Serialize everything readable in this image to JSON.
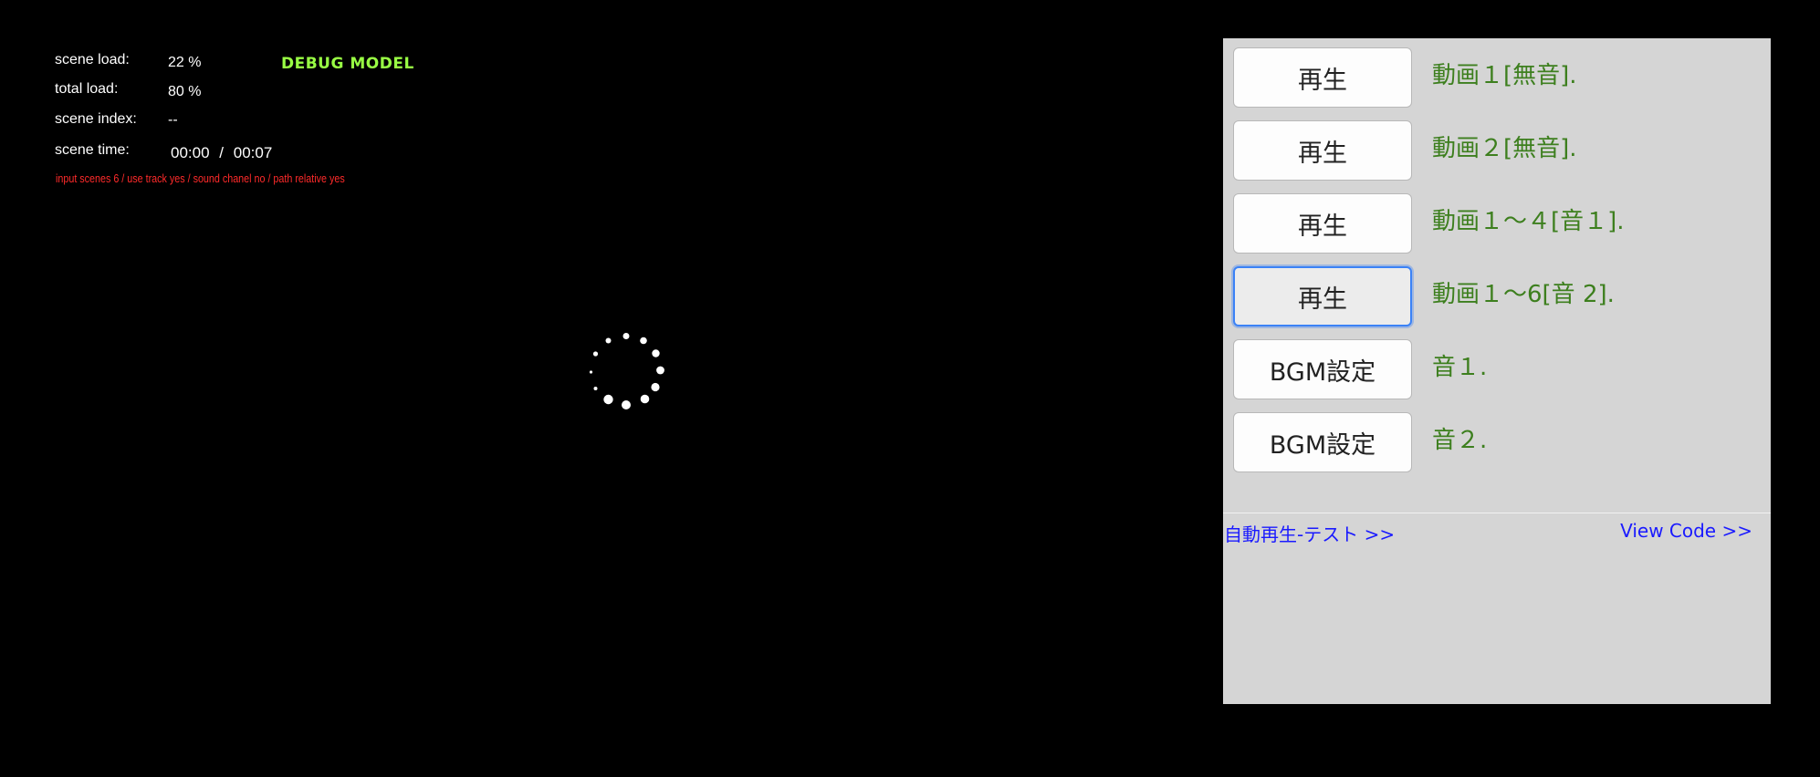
{
  "debug": {
    "title": "DEBUG MODEL",
    "rows": [
      {
        "label": "scene load:",
        "value": "22 %"
      },
      {
        "label": "total load:",
        "value": "80 %"
      },
      {
        "label": "scene index:",
        "value": "--"
      },
      {
        "label": "scene time:",
        "value": ""
      }
    ],
    "time_current": "00:00",
    "time_separator": "/",
    "time_total": "00:07",
    "info_line": "input scenes 6 / use track yes / sound chanel no / path relative yes",
    "colors": {
      "title": "#99ff44",
      "info_line": "#ff2a2a",
      "text": "#ffffff"
    }
  },
  "spinner": {
    "icon": "loading-spinner-icon",
    "color": "#ffffff"
  },
  "panel": {
    "rows": [
      {
        "button": "再生",
        "description": "動画１[無音]."
      },
      {
        "button": "再生",
        "description": "動画２[無音]."
      },
      {
        "button": "再生",
        "description": "動画１～４[音１]."
      },
      {
        "button": "再生",
        "description": "動画１～6[音 2]."
      },
      {
        "button": "BGM設定",
        "description": "音１."
      },
      {
        "button": "BGM設定",
        "description": "音２."
      }
    ],
    "focused_row": 4,
    "links": {
      "autoplay": "自動再生-テスト >>",
      "view_code": "View Code >>"
    },
    "colors": {
      "background": "#d5d5d5",
      "description": "#3d7f1e",
      "link": "#1a1aff",
      "focus": "#3b82f6"
    }
  }
}
